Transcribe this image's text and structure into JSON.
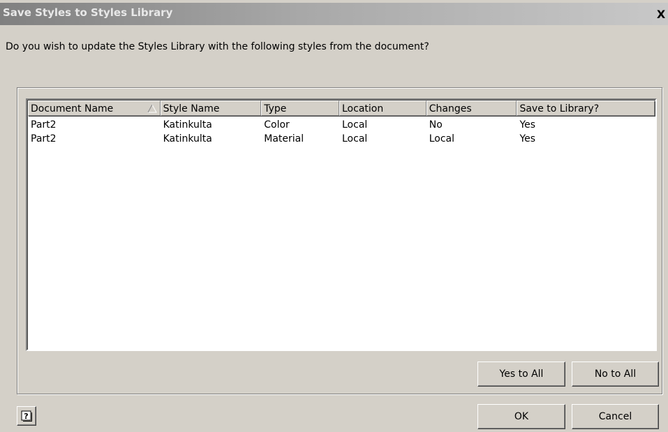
{
  "window": {
    "title": "Save Styles to Styles Library",
    "close_glyph": "X"
  },
  "prompt_text": "Do you wish to update the Styles Library with the following styles from the document?",
  "table": {
    "columns": [
      "Document Name",
      "Style Name",
      "Type",
      "Location",
      "Changes",
      "Save to Library?"
    ],
    "sort_column": "Document Name",
    "sort_direction": "ascending",
    "rows": [
      [
        "Part2",
        "Katinkulta",
        "Color",
        "Local",
        "No",
        "Yes"
      ],
      [
        "Part2",
        "Katinkulta",
        "Material",
        "Local",
        "Local",
        "Yes"
      ]
    ]
  },
  "buttons": {
    "yes_to_all": "Yes to All",
    "no_to_all": "No to All",
    "ok": "OK",
    "cancel": "Cancel",
    "help_icon": "help-question-icon"
  },
  "colors": {
    "dialog_bg": "#d4d0c8",
    "titlebar_start": "#808080",
    "titlebar_end": "#c8c8c8",
    "list_bg": "#ffffff"
  }
}
